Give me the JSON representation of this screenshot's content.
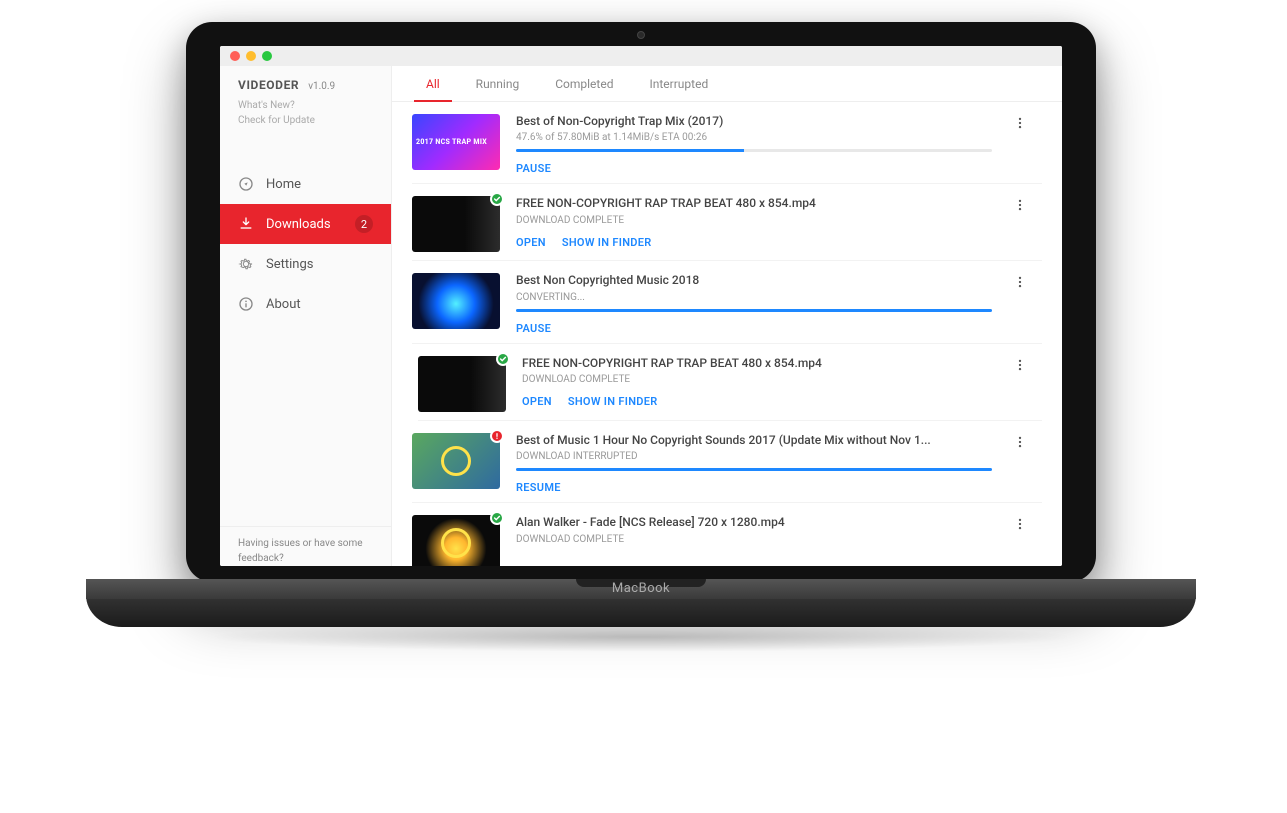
{
  "base_label": "MacBook",
  "app": {
    "title": "VIDEODER",
    "version": "v1.0.9"
  },
  "sb_links": {
    "whats_new": "What's New?",
    "check_update": "Check for Update"
  },
  "nav": {
    "home": "Home",
    "downloads": "Downloads",
    "settings": "Settings",
    "about": "About",
    "badge": "2"
  },
  "sb_footer": "Having issues or have some feedback?",
  "tabs": {
    "all": "All",
    "running": "Running",
    "completed": "Completed",
    "interrupted": "Interrupted"
  },
  "downloads": [
    {
      "title": "Best of Non-Copyright Trap Mix (2017)",
      "status": "47.6% of 57.80MiB at 1.14MiB/s ETA 00:26",
      "progress": 48,
      "actions": [
        "PAUSE"
      ],
      "badge": null,
      "indent": false,
      "thumb": "trap"
    },
    {
      "title": "FREE NON-COPYRIGHT RAP TRAP BEAT 480 x 854.mp4",
      "status": "DOWNLOAD COMPLETE",
      "progress": null,
      "actions": [
        "OPEN",
        "SHOW IN FINDER"
      ],
      "badge": "ok",
      "indent": false,
      "thumb": "dark"
    },
    {
      "title": "Best Non Copyrighted Music 2018",
      "status": "CONVERTING...",
      "progress": 100,
      "actions": [
        "PAUSE"
      ],
      "badge": null,
      "indent": false,
      "thumb": "blue"
    },
    {
      "title": "FREE NON-COPYRIGHT RAP TRAP BEAT 480 x 854.mp4",
      "status": "DOWNLOAD COMPLETE",
      "progress": null,
      "actions": [
        "OPEN",
        "SHOW IN FINDER"
      ],
      "badge": "ok",
      "indent": true,
      "thumb": "dark"
    },
    {
      "title": "Best of Music 1 Hour No Copyright Sounds 2017 (Update Mix without Nov 1...",
      "status": "DOWNLOAD INTERRUPTED",
      "progress": 100,
      "actions": [
        "RESUME"
      ],
      "badge": "err",
      "indent": false,
      "thumb": "ncs1"
    },
    {
      "title": "Alan Walker - Fade [NCS Release] 720 x 1280.mp4",
      "status": "DOWNLOAD COMPLETE",
      "progress": null,
      "actions": [],
      "badge": "ok",
      "indent": false,
      "thumb": "ncs2"
    }
  ]
}
